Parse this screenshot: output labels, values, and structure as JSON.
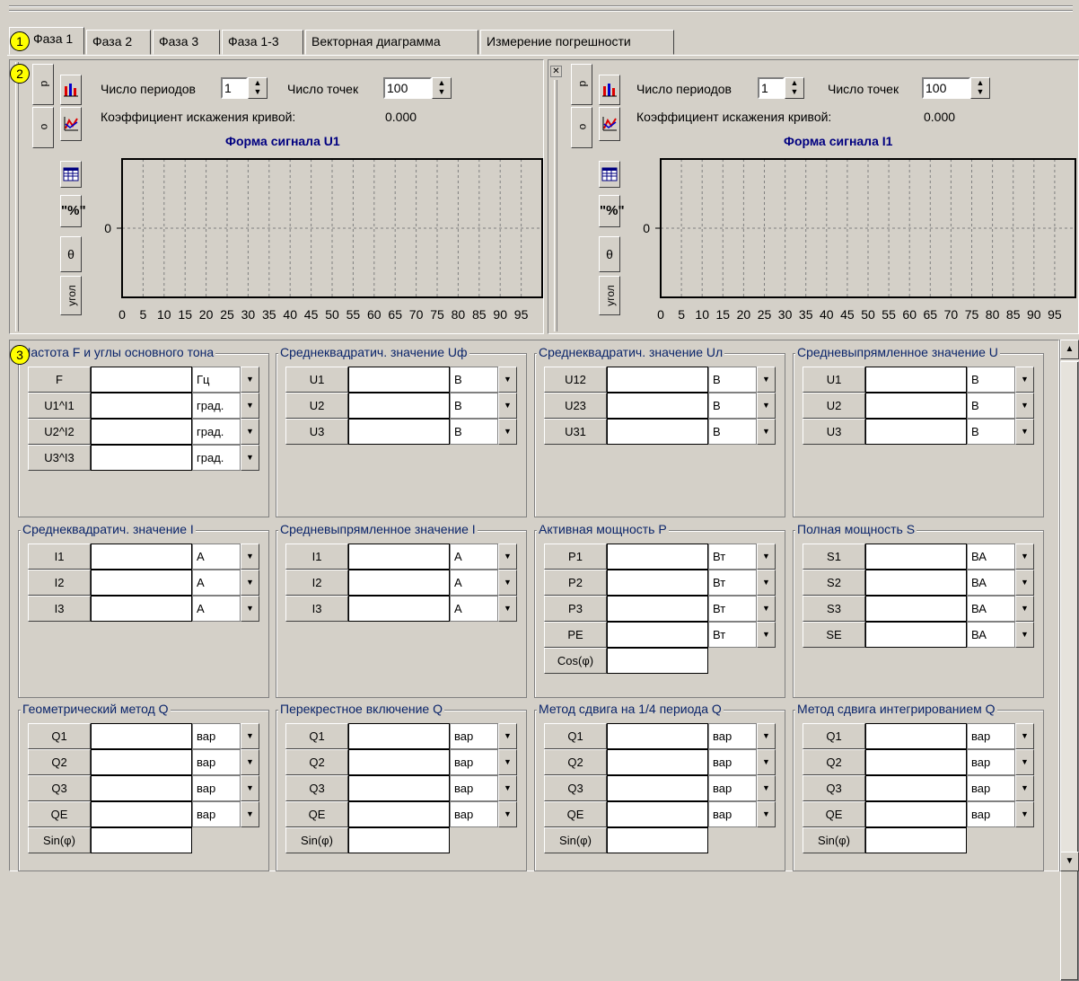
{
  "tabs": [
    {
      "label": "Фаза 1",
      "active": true
    },
    {
      "label": "Фаза 2"
    },
    {
      "label": "Фаза 3"
    },
    {
      "label": "Фаза 1-3"
    },
    {
      "label": "Векторная диаграмма"
    },
    {
      "label": "Измерение погрешности"
    }
  ],
  "markers": [
    "1",
    "2",
    "3"
  ],
  "side_buttons": {
    "p": "р",
    "o": "о",
    "percent": "\"%\"",
    "theta": "θ",
    "angle": "угол"
  },
  "left_panel": {
    "periods_label": "Число периодов",
    "periods_value": "1",
    "points_label": "Число точек",
    "points_value": "100",
    "distortion_label": "Коэффициент искажения кривой:",
    "distortion_value": "0.000",
    "chart_title": "Форма сигнала U1"
  },
  "right_panel": {
    "periods_label": "Число периодов",
    "periods_value": "1",
    "points_label": "Число точек",
    "points_value": "100",
    "distortion_label": "Коэффициент искажения кривой:",
    "distortion_value": "0.000",
    "chart_title": "Форма сигнала I1"
  },
  "close_glyph": "✕",
  "chart_data": [
    {
      "type": "line",
      "title": "Форма сигнала U1",
      "x_ticks": [
        "0",
        "5",
        "10",
        "15",
        "20",
        "25",
        "30",
        "35",
        "40",
        "45",
        "50",
        "55",
        "60",
        "65",
        "70",
        "75",
        "80",
        "85",
        "90",
        "95"
      ],
      "y_ticks": [
        "0"
      ],
      "series": [],
      "grid": true
    },
    {
      "type": "line",
      "title": "Форма сигнала I1",
      "x_ticks": [
        "0",
        "5",
        "10",
        "15",
        "20",
        "25",
        "30",
        "35",
        "40",
        "45",
        "50",
        "55",
        "60",
        "65",
        "70",
        "75",
        "80",
        "85",
        "90",
        "95"
      ],
      "y_ticks": [
        "0"
      ],
      "series": [],
      "grid": true
    }
  ],
  "groups": [
    {
      "title": "Частота F и углы основного тона",
      "rows": [
        {
          "name": "F",
          "unit": "Гц"
        },
        {
          "name": "U1^I1",
          "unit": "град."
        },
        {
          "name": "U2^I2",
          "unit": "град."
        },
        {
          "name": "U3^I3",
          "unit": "град."
        }
      ]
    },
    {
      "title": "Среднеквадратич. значение Uф",
      "rows": [
        {
          "name": "U1",
          "unit": "В"
        },
        {
          "name": "U2",
          "unit": "В"
        },
        {
          "name": "U3",
          "unit": "В"
        }
      ]
    },
    {
      "title": "Среднеквадратич. значение Uл",
      "rows": [
        {
          "name": "U12",
          "unit": "В"
        },
        {
          "name": "U23",
          "unit": "В"
        },
        {
          "name": "U31",
          "unit": "В"
        }
      ]
    },
    {
      "title": "Средневыпрямленное значение U",
      "rows": [
        {
          "name": "U1",
          "unit": "В"
        },
        {
          "name": "U2",
          "unit": "В"
        },
        {
          "name": "U3",
          "unit": "В"
        }
      ]
    },
    {
      "title": "Среднеквадратич. значение I",
      "rows": [
        {
          "name": "I1",
          "unit": "А"
        },
        {
          "name": "I2",
          "unit": "А"
        },
        {
          "name": "I3",
          "unit": "А"
        }
      ]
    },
    {
      "title": "Средневыпрямленное значение I",
      "rows": [
        {
          "name": "I1",
          "unit": "А"
        },
        {
          "name": "I2",
          "unit": "А"
        },
        {
          "name": "I3",
          "unit": "А"
        }
      ]
    },
    {
      "title": "Активная мощность P",
      "rows": [
        {
          "name": "P1",
          "unit": "Вт"
        },
        {
          "name": "P2",
          "unit": "Вт"
        },
        {
          "name": "P3",
          "unit": "Вт"
        },
        {
          "name": "PE",
          "unit": "Вт"
        },
        {
          "name": "Cos(φ)"
        }
      ]
    },
    {
      "title": "Полная мощность S",
      "rows": [
        {
          "name": "S1",
          "unit": "ВА"
        },
        {
          "name": "S2",
          "unit": "ВА"
        },
        {
          "name": "S3",
          "unit": "ВА"
        },
        {
          "name": "SE",
          "unit": "ВА"
        }
      ]
    },
    {
      "title": "Геометрический метод Q",
      "rows": [
        {
          "name": "Q1",
          "unit": "вар"
        },
        {
          "name": "Q2",
          "unit": "вар"
        },
        {
          "name": "Q3",
          "unit": "вар"
        },
        {
          "name": "QE",
          "unit": "вар"
        },
        {
          "name": "Sin(φ)"
        }
      ]
    },
    {
      "title": "Перекрестное включение Q",
      "rows": [
        {
          "name": "Q1",
          "unit": "вар"
        },
        {
          "name": "Q2",
          "unit": "вар"
        },
        {
          "name": "Q3",
          "unit": "вар"
        },
        {
          "name": "QE",
          "unit": "вар"
        },
        {
          "name": "Sin(φ)"
        }
      ]
    },
    {
      "title": "Метод сдвига на 1/4 периода Q",
      "rows": [
        {
          "name": "Q1",
          "unit": "вар"
        },
        {
          "name": "Q2",
          "unit": "вар"
        },
        {
          "name": "Q3",
          "unit": "вар"
        },
        {
          "name": "QE",
          "unit": "вар"
        },
        {
          "name": "Sin(φ)"
        }
      ]
    },
    {
      "title": "Метод сдвига интегрированием Q",
      "rows": [
        {
          "name": "Q1",
          "unit": "вар"
        },
        {
          "name": "Q2",
          "unit": "вар"
        },
        {
          "name": "Q3",
          "unit": "вар"
        },
        {
          "name": "QE",
          "unit": "вар"
        },
        {
          "name": "Sin(φ)"
        }
      ]
    }
  ],
  "scrollbar": {
    "up": "▲",
    "down": "▼"
  }
}
